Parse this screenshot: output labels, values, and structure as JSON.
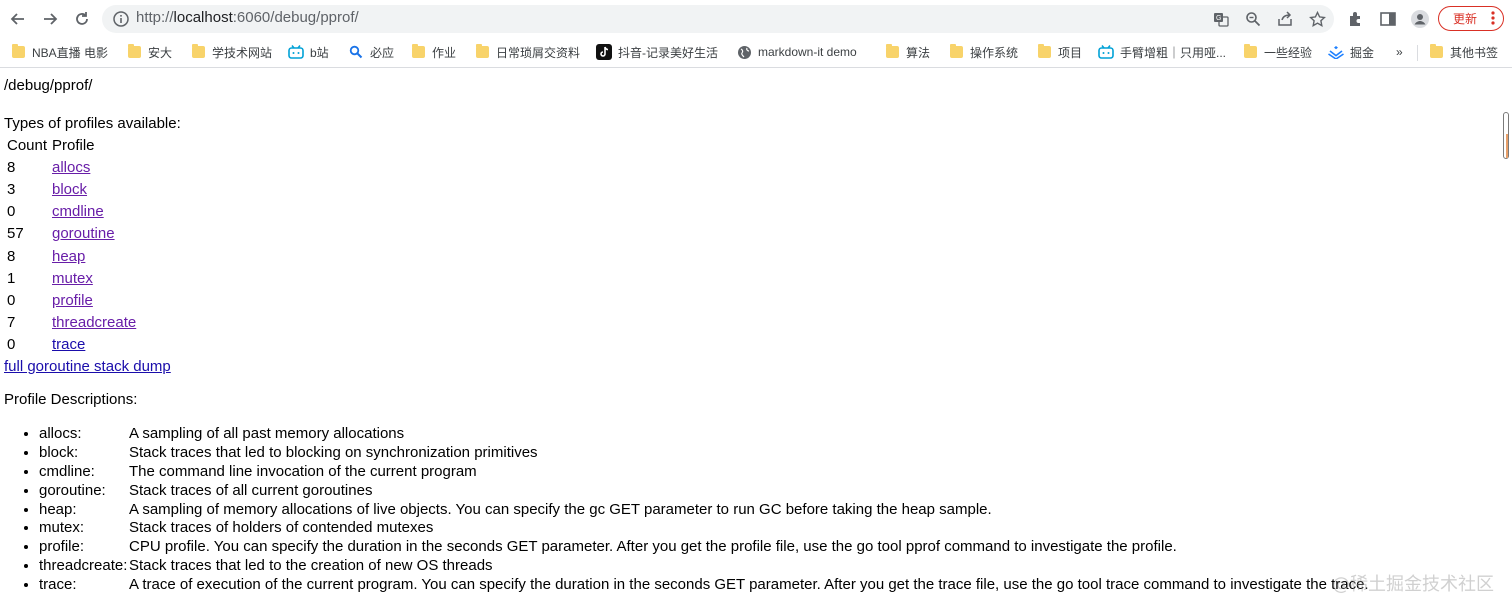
{
  "browser": {
    "url_scheme": "http://",
    "url_host": "localhost",
    "url_rest": ":6060/debug/pprof/",
    "update_label": "更新"
  },
  "bookmarks": [
    {
      "label": "NBA直播 电影",
      "icon": "folder-icon"
    },
    {
      "label": "安大",
      "icon": "folder-icon"
    },
    {
      "label": "学技术网站",
      "icon": "folder-icon"
    },
    {
      "label": "b站",
      "icon": "bilibili-icon"
    },
    {
      "label": "必应",
      "icon": "search-icon"
    },
    {
      "label": "作业",
      "icon": "folder-icon"
    },
    {
      "label": "日常琐屑交资料",
      "icon": "folder-icon"
    },
    {
      "label": "抖音-记录美好生活",
      "icon": "tiktok-icon"
    },
    {
      "label": "markdown-it demo",
      "icon": "globe-icon"
    },
    {
      "label": "算法",
      "icon": "folder-icon"
    },
    {
      "label": "操作系统",
      "icon": "folder-icon"
    },
    {
      "label": "项目",
      "icon": "folder-icon"
    },
    {
      "label": "手臂增粗｜只用哑...",
      "icon": "bilibili-icon"
    },
    {
      "label": "一些经验",
      "icon": "folder-icon"
    },
    {
      "label": "掘金",
      "icon": "juejin-icon"
    },
    {
      "label": "»",
      "icon": "overflow-icon"
    },
    {
      "label": "其他书签",
      "icon": "folder-icon"
    }
  ],
  "page": {
    "path": "/debug/pprof/",
    "types_title": "Types of profiles available:",
    "table_headers": {
      "count": "Count",
      "profile": "Profile"
    },
    "profiles": [
      {
        "count": "8",
        "name": "allocs"
      },
      {
        "count": "3",
        "name": "block"
      },
      {
        "count": "0",
        "name": "cmdline"
      },
      {
        "count": "57",
        "name": "goroutine"
      },
      {
        "count": "8",
        "name": "heap"
      },
      {
        "count": "1",
        "name": "mutex"
      },
      {
        "count": "0",
        "name": "profile"
      },
      {
        "count": "7",
        "name": "threadcreate"
      },
      {
        "count": "0",
        "name": "trace"
      }
    ],
    "full_dump_link": "full goroutine stack dump",
    "desc_title": "Profile Descriptions:",
    "descriptions": [
      {
        "name": "allocs:",
        "text": "A sampling of all past memory allocations"
      },
      {
        "name": "block:",
        "text": "Stack traces that led to blocking on synchronization primitives"
      },
      {
        "name": "cmdline:",
        "text": "The command line invocation of the current program"
      },
      {
        "name": "goroutine:",
        "text": "Stack traces of all current goroutines"
      },
      {
        "name": "heap:",
        "text": "A sampling of memory allocations of live objects. You can specify the gc GET parameter to run GC before taking the heap sample."
      },
      {
        "name": "mutex:",
        "text": "Stack traces of holders of contended mutexes"
      },
      {
        "name": "profile:",
        "text": "CPU profile. You can specify the duration in the seconds GET parameter. After you get the profile file, use the go tool pprof command to investigate the profile."
      },
      {
        "name": "threadcreate:",
        "text": "Stack traces that led to the creation of new OS threads"
      },
      {
        "name": "trace:",
        "text": "A trace of execution of the current program. You can specify the duration in the seconds GET parameter. After you get the trace file, use the go tool trace command to investigate the trace."
      }
    ]
  },
  "watermark": "@稀土掘金技术社区"
}
